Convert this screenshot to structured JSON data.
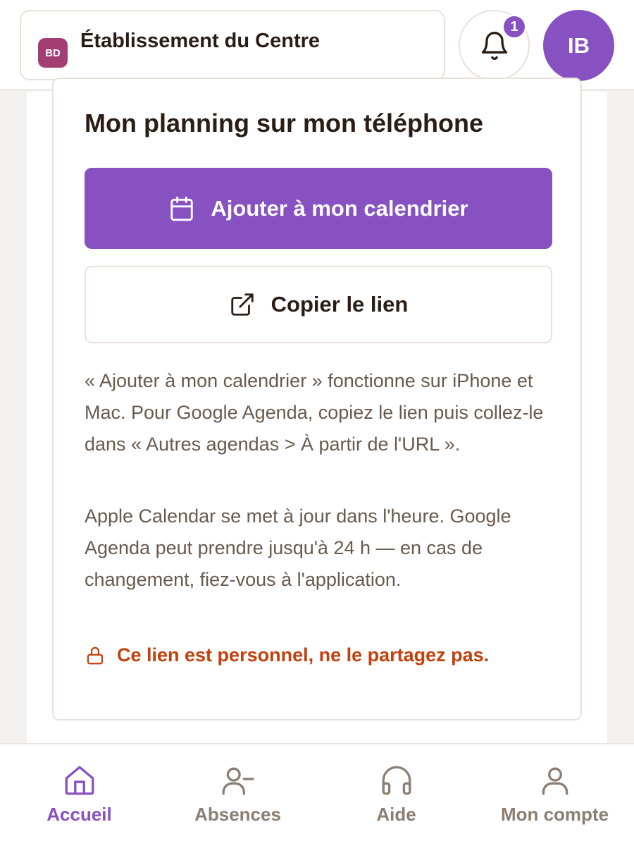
{
  "header": {
    "school_initials": "BD",
    "school_name": "Établissement du Centre",
    "notification_count": "1",
    "user_initials": "IB"
  },
  "card": {
    "title": "Mon planning sur mon téléphone",
    "add_calendar_label": "Ajouter à mon calendrier",
    "copy_link_label": "Copier le lien",
    "paragraph1": "« Ajouter à mon calendrier » fonctionne sur iPhone et Mac. Pour Google Agenda, copiez le lien puis collez-le dans « Autres agendas > À partir de l'URL ».",
    "paragraph2": "Apple Calendar se met à jour dans l'heure. Google Agenda peut prendre jusqu'à 24 h — en cas de changement, fiez-vous à l'application.",
    "warning": "Ce lien est personnel, ne le partagez pas."
  },
  "nav": {
    "items": [
      {
        "label": "Accueil",
        "icon": "home-icon",
        "active": true
      },
      {
        "label": "Absences",
        "icon": "user-minus-icon",
        "active": false
      },
      {
        "label": "Aide",
        "icon": "headphones-icon",
        "active": false
      },
      {
        "label": "Mon compte",
        "icon": "user-icon",
        "active": false
      }
    ]
  },
  "colors": {
    "accent": "#8751c2",
    "school_badge": "#a33e74",
    "warning": "#c2410c",
    "text": "#2b1d14",
    "muted": "#6a5a4c"
  }
}
